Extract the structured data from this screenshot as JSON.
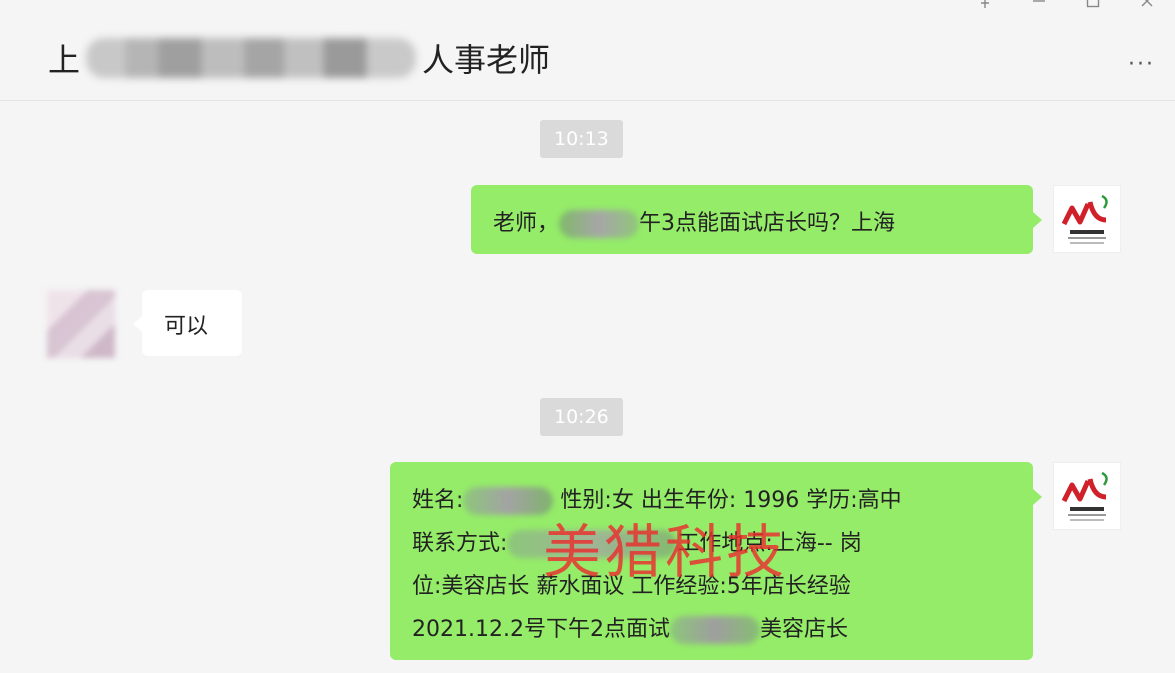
{
  "window": {
    "title_prefix": "上",
    "title_suffix": "人事老师",
    "more_label": "···",
    "controls": [
      "pin-icon",
      "minimize-icon",
      "maximize-icon",
      "close-icon"
    ]
  },
  "messages": [
    {
      "type": "time",
      "text": "10:13"
    },
    {
      "type": "sent",
      "before": "老师，",
      "after": "午3点能面试店长吗？上海"
    },
    {
      "type": "received",
      "text": "可以"
    },
    {
      "type": "time",
      "text": "10:26"
    },
    {
      "type": "sent",
      "lines": [
        {
          "a": "姓名:",
          "b": " 性别:女  出生年份: 1996  学历:高中"
        },
        {
          "a": " 联系方式:",
          "b": "工作地点:上海-- 岗"
        },
        {
          "a": "位:美容店长 薪水面议 工作经验:5年店长经验",
          "b": ""
        },
        {
          "a": "2021.12.2号下午2点面试",
          "b": "美容店长"
        }
      ]
    }
  ],
  "watermark": "美猎科技",
  "avatar": {
    "logo_text": "ML",
    "logo_caption": "美猎客服1"
  },
  "colors": {
    "sent_bubble": "#95ec69",
    "received_bubble": "#ffffff",
    "watermark": "#ea2d2d",
    "background": "#f5f5f5"
  }
}
